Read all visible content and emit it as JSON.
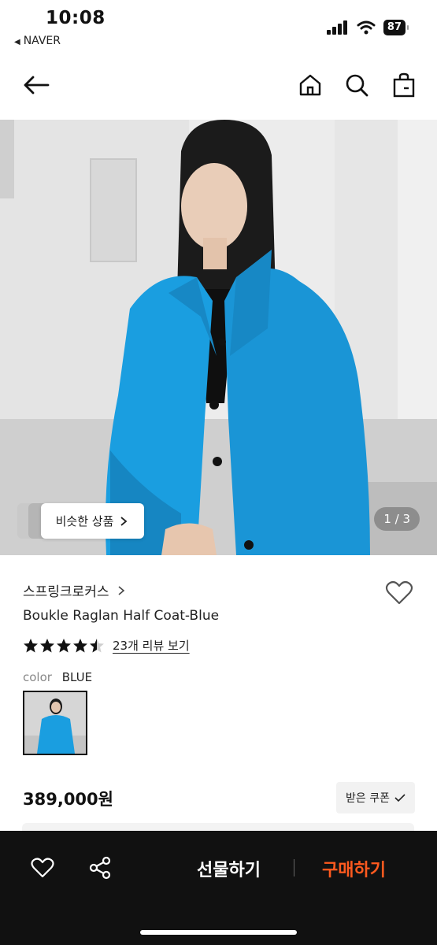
{
  "status_bar": {
    "time": "10:08",
    "back_app": "NAVER",
    "battery": "87"
  },
  "nav": {
    "icons": [
      "back-arrow-icon",
      "home-icon",
      "search-icon",
      "shopping-bag-icon"
    ]
  },
  "hero": {
    "similar_label": "비슷한 상품",
    "page_indicator": "1 / 3",
    "accent_color": "#1a9ee0"
  },
  "product": {
    "brand": "스프링크로커스",
    "name": "Boukle Raglan Half Coat-Blue",
    "rating": 4.5,
    "review_link": "23개 리뷰 보기",
    "color_label": "color",
    "color_value": "BLUE",
    "price": "389,000원",
    "coupon_label": "받은 쿠폰"
  },
  "bottom_bar": {
    "gift_label": "선물하기",
    "buy_label": "구매하기",
    "buy_color": "#ff5a1f"
  }
}
